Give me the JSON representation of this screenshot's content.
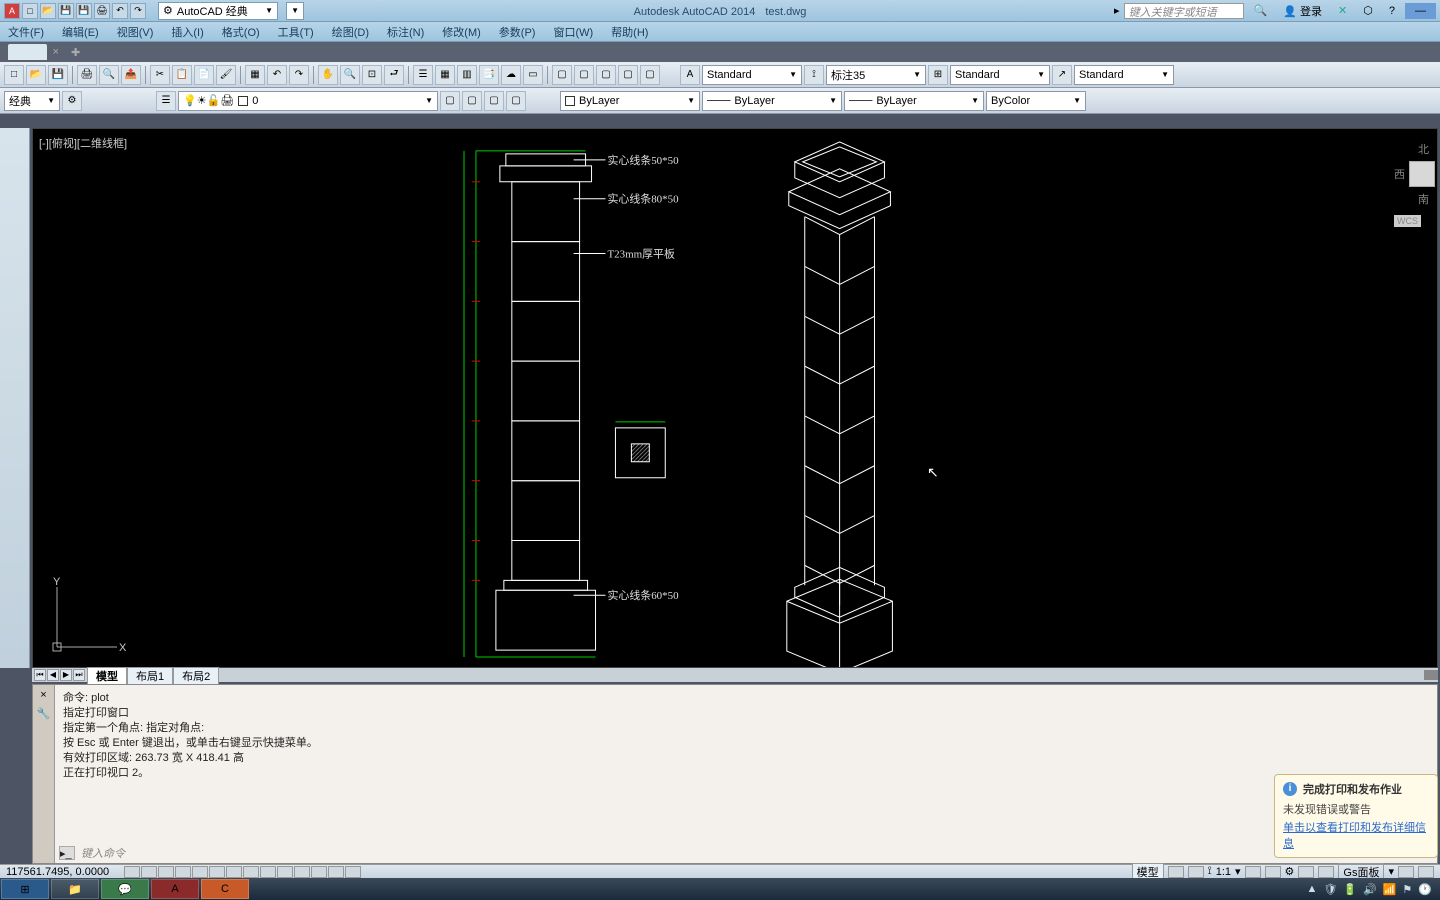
{
  "title": {
    "app": "Autodesk AutoCAD 2014",
    "file": "test.dwg"
  },
  "search": {
    "placeholder": "键入关键字或短语"
  },
  "login": {
    "text": "登录"
  },
  "workspace_combo": "AutoCAD 经典",
  "menus": [
    "文件(F)",
    "编辑(E)",
    "视图(V)",
    "插入(I)",
    "格式(O)",
    "工具(T)",
    "绘图(D)",
    "标注(N)",
    "修改(M)",
    "参数(P)",
    "窗口(W)",
    "帮助(H)"
  ],
  "style_bar": {
    "text_style": "Standard",
    "dim_style": "标注35",
    "table_style": "Standard",
    "mleader_style": "Standard"
  },
  "props_bar": {
    "layer_combo": "0",
    "workspace2": "经典",
    "color": "ByLayer",
    "linetype": "ByLayer",
    "lineweight": "ByLayer",
    "plotstyle": "ByColor"
  },
  "viewport_label": "[-][俯视][二维线框]",
  "viewcube": {
    "n": "北",
    "w": "西",
    "s": "南",
    "wcs": "WCS"
  },
  "annotations": {
    "a1": "实心线条50*50",
    "a2": "实心线条80*50",
    "a3": "T23mm厚平板",
    "a4": "实心线条60*50"
  },
  "layout_tabs": {
    "t1": "模型",
    "t2": "布局1",
    "t3": "布局2"
  },
  "cmd": {
    "l1": "命令: plot",
    "l2": "指定打印窗口",
    "l3": "指定第一个角点: 指定对角点:",
    "l4": "按 Esc 或 Enter 键退出，或单击右键显示快捷菜单。",
    "l5": "有效打印区域:  263.73 宽 X 418.41 高",
    "l6": "正在打印视口 2。",
    "prompt_placeholder": "键入命令"
  },
  "notify": {
    "title": "完成打印和发布作业",
    "body": "未发现错误或警告",
    "link": "单击以查看打印和发布详细信息"
  },
  "status": {
    "coords": "117561.7495, 0.0000",
    "scale": "1:1",
    "panel": "Gs面板",
    "model_btn": "模型"
  },
  "ucs": {
    "x": "X",
    "y": "Y"
  }
}
